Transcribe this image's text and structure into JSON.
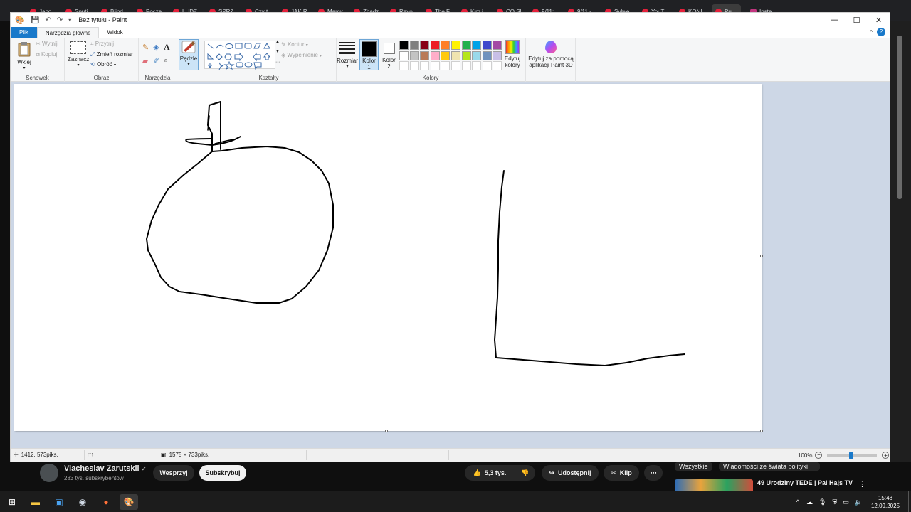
{
  "browser_tabs": [
    {
      "label": "Japo…",
      "icon": "youtube-icon"
    },
    {
      "label": "Sputi…",
      "icon": "youtube-icon"
    },
    {
      "label": "Blind",
      "icon": "youtube-icon"
    },
    {
      "label": "Pocza…",
      "icon": "youtube-icon"
    },
    {
      "label": "LUDZ…",
      "icon": "youtube-icon"
    },
    {
      "label": "SPRZ…",
      "icon": "youtube-icon"
    },
    {
      "label": "Czy t…",
      "icon": "youtube-icon"
    },
    {
      "label": "JAK R…",
      "icon": "youtube-icon"
    },
    {
      "label": "Mamy…",
      "icon": "youtube-icon"
    },
    {
      "label": "Zbadz…",
      "icon": "youtube-icon"
    },
    {
      "label": "Revo…",
      "icon": "youtube-icon"
    },
    {
      "label": "The F…",
      "icon": "youtube-icon"
    },
    {
      "label": "Kim j…",
      "icon": "youtube-icon"
    },
    {
      "label": "CO SI…",
      "icon": "youtube-icon"
    },
    {
      "label": "9/11:…",
      "icon": "youtube-icon"
    },
    {
      "label": "9/11 -…",
      "icon": "youtube-icon"
    },
    {
      "label": "Sylwe…",
      "icon": "youtube-icon"
    },
    {
      "label": "YouT…",
      "icon": "youtube-icon"
    },
    {
      "label": "KONI…",
      "icon": "youtube-icon"
    },
    {
      "label": "Pu…",
      "icon": "youtube-icon"
    },
    {
      "label": "Insta…",
      "icon": "instagram-icon"
    }
  ],
  "paint": {
    "title": "Bez tytułu - Paint",
    "menu": {
      "file": "Plik",
      "home": "Narzędzia główne",
      "view": "Widok"
    },
    "clipboard": {
      "paste": "Wklej",
      "cut": "Wytnij",
      "copy": "Kopiuj",
      "group": "Schowek"
    },
    "image": {
      "select": "Zaznacz",
      "crop": "Przytnij",
      "resize": "Zmień rozmiar",
      "rotate": "Obróć",
      "group": "Obraz"
    },
    "tools": {
      "group": "Narzędzia"
    },
    "brushes": {
      "label": "Pędzle"
    },
    "shapes": {
      "outline": "Kontur",
      "fill": "Wypełnienie",
      "group": "Kształty"
    },
    "size": {
      "label": "Rozmiar"
    },
    "colors": {
      "color1": "Kolor",
      "color1_num": "1",
      "color2": "Kolor",
      "color2_num": "2",
      "edit": "Edytuj",
      "edit2": "kolory",
      "group": "Kolory",
      "palette_row1": [
        "#000000",
        "#7f7f7f",
        "#880015",
        "#ed1c24",
        "#ff7f27",
        "#fff200",
        "#22b14c",
        "#00a2e8",
        "#3f48cc",
        "#a349a4"
      ],
      "palette_row2": [
        "#ffffff",
        "#c3c3c3",
        "#b97a57",
        "#ffaec9",
        "#ffc90e",
        "#efe4b0",
        "#b5e61d",
        "#99d9ea",
        "#7092be",
        "#c8bfe7"
      ],
      "current1": "#000000",
      "current2": "#ffffff"
    },
    "paint3d": {
      "line1": "Edytuj za pomocą",
      "line2": "aplikacji Paint 3D"
    },
    "status": {
      "cursor": "1412, 573piks.",
      "canvas_size": "1575 × 733piks.",
      "zoom": "100%"
    }
  },
  "youtube": {
    "channel": "Viacheslav Zarutskii",
    "subscribers": "283 tys. subskrybentów",
    "support": "Wesprzyj",
    "subscribe": "Subskrybuj",
    "likes": "5,3 tys.",
    "share": "Udostępnij",
    "clip": "Klip",
    "chips": [
      "Wszystkie",
      "Wiadomości ze świata polityki"
    ],
    "video_title": "49 Urodziny TEDE | Pal Hajs TV"
  },
  "taskbar": {
    "time": "15:48",
    "date": "12.09.2025"
  }
}
